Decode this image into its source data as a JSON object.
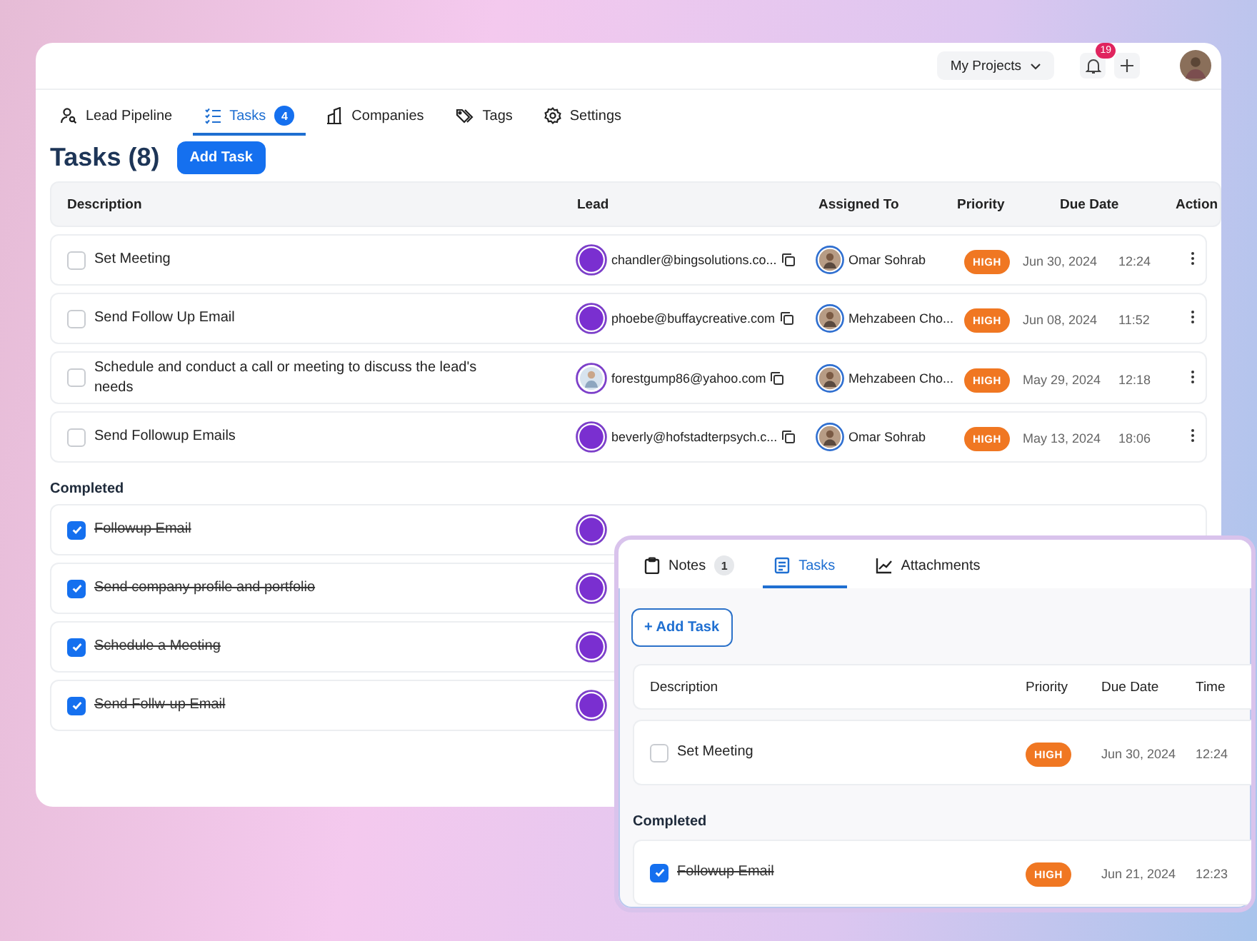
{
  "topbar": {
    "project_menu": "My Projects",
    "notifications": "19"
  },
  "tabs": [
    {
      "label": "Lead Pipeline",
      "selected": false
    },
    {
      "label": "Tasks",
      "badge": "4",
      "selected": true
    },
    {
      "label": "Companies",
      "selected": false
    },
    {
      "label": "Tags",
      "selected": false
    },
    {
      "label": "Settings",
      "selected": false
    }
  ],
  "title": "Tasks (8)",
  "add_button": "Add Task",
  "columns": [
    "Description",
    "Lead",
    "Assigned To",
    "Priority",
    "Due Date",
    "Action"
  ],
  "tasks": [
    {
      "description": "Set Meeting",
      "checked": false,
      "lead": {
        "email": "chandler@bingsolutions.co...",
        "kind": "plain"
      },
      "assignee": "Omar Sohrab",
      "priority": "HIGH",
      "due_date": "Jun 30, 2024",
      "time": "12:24"
    },
    {
      "description": "Send Follow Up Email",
      "checked": false,
      "lead": {
        "email": "phoebe@buffaycreative.com",
        "kind": "plain"
      },
      "assignee": "Mehzabeen Cho...",
      "priority": "HIGH",
      "due_date": "Jun 08, 2024",
      "time": "11:52"
    },
    {
      "description": "Schedule and conduct a call or meeting to discuss the lead's needs",
      "checked": false,
      "lead": {
        "email": "forestgump86@yahoo.com"
      },
      "assignee": "Mehzabeen Cho...",
      "priority": "HIGH",
      "due_date": "May 29, 2024",
      "time": "12:18"
    },
    {
      "description": "Send Followup Emails",
      "checked": false,
      "lead": {
        "email": "beverly@hofstadterpsych.c...",
        "kind": "plain"
      },
      "assignee": "Omar Sohrab",
      "priority": "HIGH",
      "due_date": "May 13, 2024",
      "time": "18:06"
    }
  ],
  "completed_label": "Completed",
  "completed": [
    {
      "description": "Followup Email",
      "checked": true
    },
    {
      "description": "Send company profile and portfolio",
      "checked": true
    },
    {
      "description": "Schedule a Meeting",
      "checked": true
    },
    {
      "description": "Send Follw-up Email",
      "checked": true
    }
  ],
  "panel": {
    "tabs": [
      {
        "label": "Notes",
        "badge": "1",
        "selected": false
      },
      {
        "label": "Tasks",
        "selected": true
      },
      {
        "label": "Attachments",
        "selected": false
      }
    ],
    "add_button": "+ Add Task",
    "columns": [
      "Description",
      "Priority",
      "Due Date",
      "Time"
    ],
    "tasks": [
      {
        "description": "Set Meeting",
        "checked": false,
        "priority": "HIGH",
        "due_date": "Jun 30, 2024",
        "time": "12:24"
      }
    ],
    "completed_label": "Completed",
    "completed": [
      {
        "description": "Followup Email",
        "checked": true,
        "priority": "HIGH",
        "due_date": "Jun 21, 2024",
        "time": "12:23"
      }
    ]
  }
}
